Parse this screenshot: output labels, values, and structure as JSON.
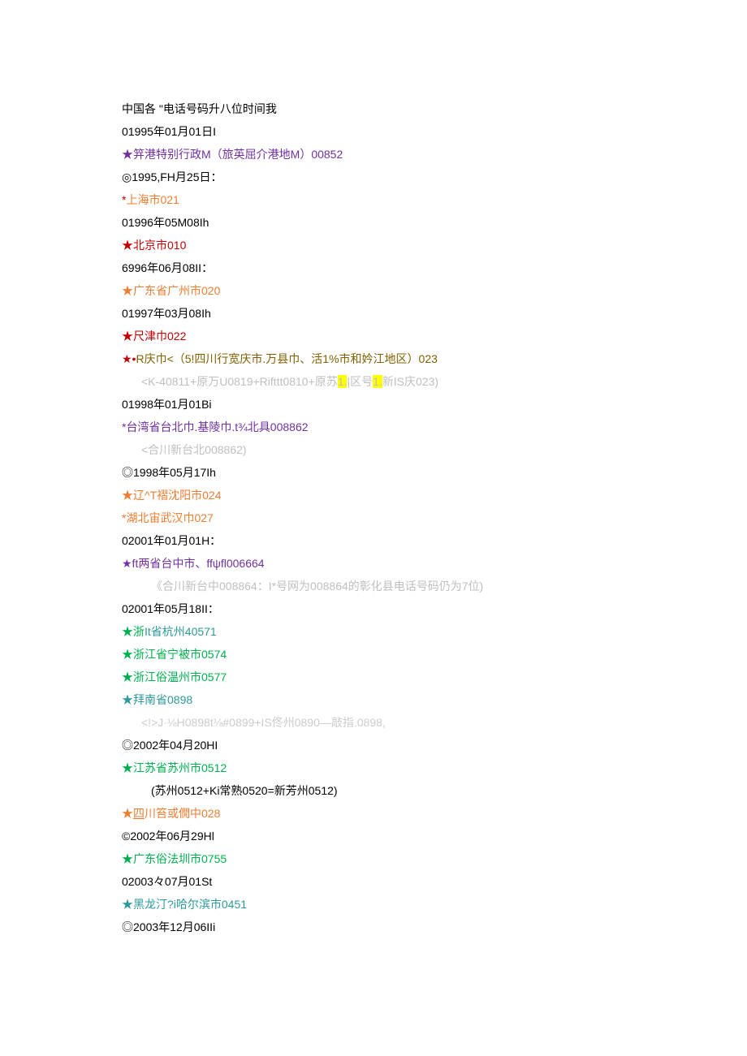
{
  "title": "中国各 \"电话号码升八位时间我",
  "lines": [
    {
      "cls": "date",
      "parts": [
        {
          "t": "01995年01月01日I"
        }
      ]
    },
    {
      "cls": "",
      "parts": [
        {
          "cls": "star-purple",
          "t": "★笄"
        },
        {
          "cls": "txt-purple",
          "t": "港特别行政M（旅英屈介港地M）00852"
        }
      ]
    },
    {
      "cls": "date",
      "parts": [
        {
          "t": "◎1995,FH月25日："
        }
      ]
    },
    {
      "cls": "",
      "parts": [
        {
          "cls": "star-red",
          "t": "*"
        },
        {
          "cls": "txt-orange",
          "t": "上海市021"
        }
      ]
    },
    {
      "cls": "date",
      "parts": [
        {
          "t": "01996年05M08Ih"
        }
      ]
    },
    {
      "cls": "",
      "parts": [
        {
          "cls": "star-red",
          "t": "★北"
        },
        {
          "cls": "txt-red",
          "t": "京市010"
        }
      ]
    },
    {
      "cls": "date",
      "parts": [
        {
          "t": "6996年06月08II："
        }
      ]
    },
    {
      "cls": "",
      "parts": [
        {
          "cls": "star-orange",
          "t": "★广"
        },
        {
          "cls": "txt-orange",
          "t": "东省广州市020"
        }
      ]
    },
    {
      "cls": "date",
      "parts": [
        {
          "t": "01997年03月08Ih"
        }
      ]
    },
    {
      "cls": "",
      "parts": [
        {
          "cls": "star-red",
          "t": "★尺"
        },
        {
          "cls": "txt-red",
          "t": "津巾022"
        }
      ]
    },
    {
      "cls": "",
      "parts": [
        {
          "cls": "star-red",
          "t": "★•"
        },
        {
          "cls": "txt-brown",
          "t": "R庆巾<（5!四川行宽庆市.万县巾、活1%市和妗江地区）023"
        }
      ]
    },
    {
      "cls": "indent1",
      "parts": [
        {
          "cls": "txt-gray",
          "t": "<K-40811+原万U0819+Rifttt0810+原苏"
        },
        {
          "cls": "txt-gray hl",
          "t": "1."
        },
        {
          "cls": "txt-gray",
          "t": "|区号"
        },
        {
          "cls": "txt-gray hl",
          "t": "1."
        },
        {
          "cls": "txt-gray",
          "t": "新IS庆023)"
        }
      ]
    },
    {
      "cls": "date",
      "parts": [
        {
          "t": "01998年01月01Bi"
        }
      ]
    },
    {
      "cls": "",
      "parts": [
        {
          "cls": "txt-purple",
          "t": "*台"
        },
        {
          "cls": "txt-purple",
          "t": "湾省台北巾.基陵巾.t¾北具008862"
        }
      ]
    },
    {
      "cls": "indent1",
      "parts": [
        {
          "cls": "txt-gray",
          "t": "<合川新台北008862)"
        }
      ]
    },
    {
      "cls": "date",
      "parts": [
        {
          "t": "◎1998年05月17Ih"
        }
      ]
    },
    {
      "cls": "",
      "parts": [
        {
          "cls": "star-orange",
          "t": "★辽"
        },
        {
          "cls": "txt-orange",
          "t": "^T褶沈阳市024"
        }
      ]
    },
    {
      "cls": "",
      "parts": [
        {
          "cls": "txt-orange",
          "t": "*湖北宙武汉巾027"
        }
      ]
    },
    {
      "cls": "date",
      "parts": [
        {
          "t": "02001年01月01H："
        }
      ]
    },
    {
      "cls": "",
      "parts": [
        {
          "cls": "star-purple",
          "t": "★ft"
        },
        {
          "cls": "txt-purple",
          "t": "两省台中市、ffψfl006664"
        }
      ]
    },
    {
      "cls": "indent2",
      "parts": [
        {
          "cls": "txt-gray",
          "t": "《合川新台中008864：I*号网为008864的彰化县电话号码仍为7位)"
        }
      ]
    },
    {
      "cls": "date",
      "parts": [
        {
          "t": "02001年05月18II："
        }
      ]
    },
    {
      "cls": "",
      "parts": [
        {
          "cls": "star-green",
          "t": "★浙"
        },
        {
          "cls": "txt-teal",
          "t": "It省杭州40571"
        }
      ]
    },
    {
      "cls": "",
      "parts": [
        {
          "cls": "star-green",
          "t": "★浙"
        },
        {
          "cls": "txt-green",
          "t": "江省宁被市0574"
        }
      ]
    },
    {
      "cls": "",
      "parts": [
        {
          "cls": "star-green",
          "t": "★浙"
        },
        {
          "cls": "txt-green",
          "t": "江俗温州市0577"
        }
      ]
    },
    {
      "cls": "",
      "parts": [
        {
          "cls": "star-teal",
          "t": "★拜"
        },
        {
          "cls": "txt-teal",
          "t": "南省0898"
        }
      ]
    },
    {
      "cls": "indent1",
      "parts": [
        {
          "cls": "txt-lightgray",
          "t": "<!>J·⅛H0898t⅛#0899+IS佟州0890—敲指.0898,"
        }
      ]
    },
    {
      "cls": "date",
      "parts": [
        {
          "t": "◎2002年04月20HI"
        }
      ]
    },
    {
      "cls": "",
      "parts": [
        {
          "cls": "star-green",
          "t": "★江"
        },
        {
          "cls": "txt-green",
          "t": "苏省苏州市0512"
        }
      ]
    },
    {
      "cls": "indent2",
      "parts": [
        {
          "t": "(苏州0512+Ki常熟0520=新芳州0512)"
        }
      ]
    },
    {
      "cls": "",
      "parts": [
        {
          "cls": "star-orange",
          "t": "★"
        },
        {
          "cls": "txt-orange underline",
          "t": "四"
        },
        {
          "cls": "txt-orange",
          "t": "川笞或僩中028"
        }
      ]
    },
    {
      "cls": "date",
      "parts": [
        {
          "t": "©2002年06月29Hl"
        }
      ]
    },
    {
      "cls": "",
      "parts": [
        {
          "cls": "star-green",
          "t": "★广"
        },
        {
          "cls": "txt-green",
          "t": "东俗法圳市0755"
        }
      ]
    },
    {
      "cls": "date",
      "parts": [
        {
          "t": "02003々07月01St"
        }
      ]
    },
    {
      "cls": "",
      "parts": [
        {
          "cls": "star-teal",
          "t": "★"
        },
        {
          "cls": "txt-teal",
          "t": "黑龙汀?i哈尔滨市0451"
        }
      ]
    },
    {
      "cls": "date",
      "parts": [
        {
          "t": "◎2003年12月06IIi"
        }
      ]
    }
  ]
}
